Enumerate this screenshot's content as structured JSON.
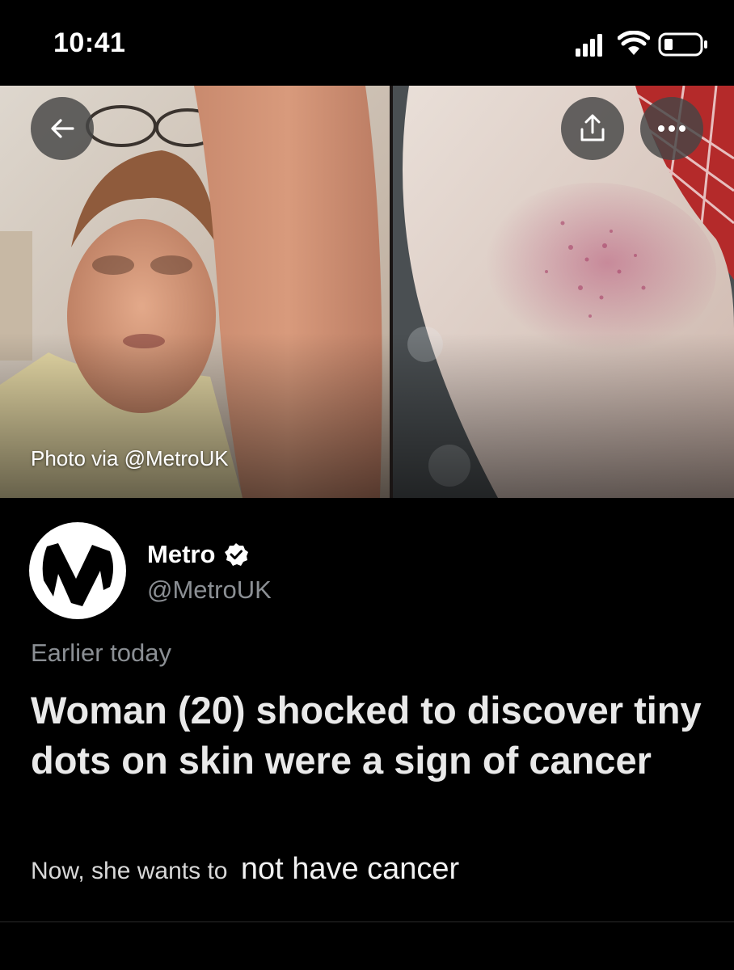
{
  "status_bar": {
    "time": "10:41",
    "icons": [
      "signal-icon",
      "wifi-icon",
      "battery-icon"
    ]
  },
  "media": {
    "photo_credit": "Photo via @MetroUK",
    "buttons": {
      "back": "arrow-left-icon",
      "share": "share-icon",
      "more": "more-horizontal-icon"
    }
  },
  "tweet": {
    "account_name": "Metro",
    "account_handle": "@MetroUK",
    "verified": true,
    "timestamp": "Earlier today",
    "headline": "Woman (20) shocked to discover tiny dots on skin were a sign of cancer",
    "subline_prefix": "Now, she wants to",
    "subline_edit": "not have cancer"
  },
  "colors": {
    "background": "#000000",
    "text_primary": "#e9e9e9",
    "text_secondary": "#8b8f94",
    "button_overlay": "#464646"
  }
}
